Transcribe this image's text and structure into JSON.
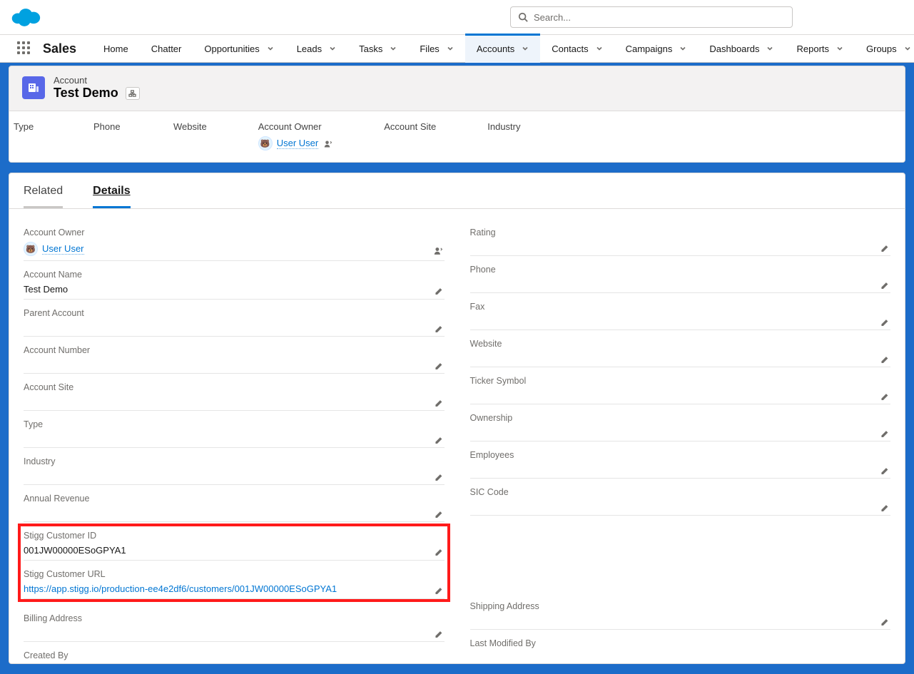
{
  "search": {
    "placeholder": "Search..."
  },
  "app_name": "Sales",
  "nav": [
    {
      "label": "Home",
      "chev": false
    },
    {
      "label": "Chatter",
      "chev": false
    },
    {
      "label": "Opportunities",
      "chev": true
    },
    {
      "label": "Leads",
      "chev": true
    },
    {
      "label": "Tasks",
      "chev": true
    },
    {
      "label": "Files",
      "chev": true
    },
    {
      "label": "Accounts",
      "chev": true,
      "active": true
    },
    {
      "label": "Contacts",
      "chev": true
    },
    {
      "label": "Campaigns",
      "chev": true
    },
    {
      "label": "Dashboards",
      "chev": true
    },
    {
      "label": "Reports",
      "chev": true
    },
    {
      "label": "Groups",
      "chev": true
    }
  ],
  "record": {
    "object_label": "Account",
    "name": "Test Demo",
    "owner": "User User"
  },
  "header_fields": {
    "type": {
      "label": "Type",
      "value": ""
    },
    "phone": {
      "label": "Phone",
      "value": ""
    },
    "website": {
      "label": "Website",
      "value": ""
    },
    "owner": {
      "label": "Account Owner"
    },
    "site": {
      "label": "Account Site",
      "value": ""
    },
    "industry": {
      "label": "Industry",
      "value": ""
    }
  },
  "tabs": {
    "related": "Related",
    "details": "Details"
  },
  "fields_left": {
    "owner": {
      "label": "Account Owner",
      "value": "User User"
    },
    "account_name": {
      "label": "Account Name",
      "value": "Test Demo"
    },
    "parent_account": {
      "label": "Parent Account",
      "value": ""
    },
    "account_number": {
      "label": "Account Number",
      "value": ""
    },
    "account_site": {
      "label": "Account Site",
      "value": ""
    },
    "type": {
      "label": "Type",
      "value": ""
    },
    "industry": {
      "label": "Industry",
      "value": ""
    },
    "annual_revenue": {
      "label": "Annual Revenue",
      "value": ""
    },
    "stigg_id": {
      "label": "Stigg Customer ID",
      "value": "001JW00000ESoGPYA1"
    },
    "stigg_url": {
      "label": "Stigg Customer URL",
      "value": "https://app.stigg.io/production-ee4e2df6/customers/001JW00000ESoGPYA1"
    },
    "billing": {
      "label": "Billing Address",
      "value": ""
    },
    "created_by": {
      "label": "Created By",
      "value": ""
    }
  },
  "fields_right": {
    "rating": {
      "label": "Rating",
      "value": ""
    },
    "phone": {
      "label": "Phone",
      "value": ""
    },
    "fax": {
      "label": "Fax",
      "value": ""
    },
    "website": {
      "label": "Website",
      "value": ""
    },
    "ticker": {
      "label": "Ticker Symbol",
      "value": ""
    },
    "ownership": {
      "label": "Ownership",
      "value": ""
    },
    "employees": {
      "label": "Employees",
      "value": ""
    },
    "sic": {
      "label": "SIC Code",
      "value": ""
    },
    "shipping": {
      "label": "Shipping Address",
      "value": ""
    },
    "modified_by": {
      "label": "Last Modified By",
      "value": ""
    }
  }
}
